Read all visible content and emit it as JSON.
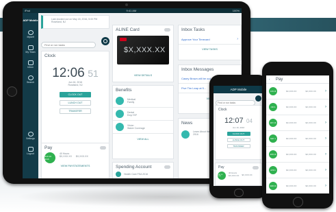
{
  "tablet": {
    "status": {
      "left": "iPad",
      "time": "9:41 AM",
      "right": "100%"
    },
    "sidebar": [
      {
        "label": "Myself"
      },
      {
        "label": "My Team"
      },
      {
        "label": "Inbox"
      },
      {
        "label": "Search"
      },
      {
        "label": "Settings"
      },
      {
        "label": "Logout"
      }
    ],
    "app_label": "ADP Mobile",
    "search_placeholder": "Find or run tasks",
    "last_login": {
      "line1": "Last clocked out on May 18, 2016, 5:00 PM",
      "line2": "Roseland, NJ"
    },
    "clock": {
      "title": "Clock",
      "time": "12:06",
      "seconds": "51",
      "date": "Jun 16, 2016",
      "location": "Roseland, NJ",
      "clock_out": "CLOCK OUT",
      "lunch_out": "LUNCH OUT",
      "transfer": "TRANSFER"
    },
    "aline": {
      "title": "ALINE Card",
      "amount": "$X,XXX.XX",
      "view_details": "VIEW DETAILS"
    },
    "benefits": {
      "title": "Benefits",
      "items": [
        {
          "name": "Medical",
          "sub": "Family"
        },
        {
          "name": "Dental",
          "sub": "Emp+SP"
        },
        {
          "name": "Vision",
          "sub": "Waive Coverage"
        }
      ],
      "view_all": "VIEW ALL"
    },
    "pay": {
      "title": "Pay",
      "badge": "JUN 16 2016",
      "hours": "40 Hours",
      "amt1": "$X,XXX.XX",
      "amt2": "$X,XXX.XX",
      "view": "VIEW PAYSTATEMENTS"
    },
    "spending": {
      "title": "Spending Account",
      "item": "Health Care FSA 2016"
    },
    "inbox_tasks": {
      "title": "Inbox Tasks",
      "item": "Approve Your Timecard",
      "view": "VIEW TASKS"
    },
    "inbox_messages": {
      "title": "Inbox Messages",
      "items": [
        "Casey Brown will be out...",
        "Five Tim Leap at 5..."
      ],
      "view": "VIEW"
    },
    "news": {
      "title": "News",
      "item": "Learn About the Government May 18, 2016"
    }
  },
  "phone_small": {
    "header": "ADP Mobile",
    "search_placeholder": "Find or run tasks",
    "clock": {
      "title": "Clock",
      "time": "12:07",
      "seconds": "04",
      "date": "Jun 16, 2016",
      "clock_out": "CLOCK OUT",
      "lunch_out": "LUNCH OUT",
      "transfer": "TRANSFER"
    },
    "pay": {
      "title": "Pay",
      "badge": "JUN 16 2016",
      "hours": "40 Hours",
      "amt1": "$X,XXX.XX",
      "amt2": "$X,XXX.XX"
    }
  },
  "phone_large": {
    "header": "Pay",
    "rows": [
      {
        "badge": "JUN 16",
        "a1": "$X,XXX.XX",
        "a2": "$X,XXX.XX"
      },
      {
        "badge": "JUN 1",
        "a1": "$X,XXX.XX",
        "a2": "$X,XXX.XX"
      },
      {
        "badge": "MAY 16",
        "a1": "$X,XXX.XX",
        "a2": "$X,XXX.XX"
      },
      {
        "badge": "MAY 1",
        "a1": "$X,XXX.XX",
        "a2": "$X,XXX.XX"
      },
      {
        "badge": "APR 16",
        "a1": "$X,XXX.XX",
        "a2": "$X,XXX.XX"
      },
      {
        "badge": "APR 1",
        "a1": "$X,XXX.XX",
        "a2": "$X,XXX.XX"
      },
      {
        "badge": "MAR 16",
        "a1": "$X,XXX.XX",
        "a2": "$X,XXX.XX"
      }
    ]
  },
  "colors": {
    "sidebar": "#133b48",
    "accent": "#2aa39a",
    "green": "#2fb14f"
  }
}
